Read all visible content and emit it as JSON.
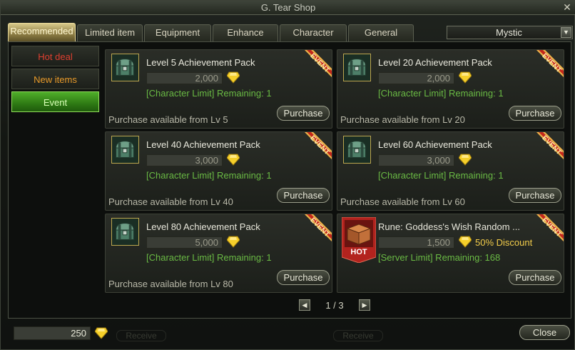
{
  "window": {
    "title": "G. Tear Shop",
    "close_symbol": "✕"
  },
  "tabs": [
    "Recommended",
    "Limited item",
    "Equipment",
    "Enhance",
    "Character",
    "General"
  ],
  "active_tab": "Recommended",
  "server_select": {
    "value": "Mystic",
    "arrow": "▼"
  },
  "sidebar": [
    "Hot deal",
    "New items",
    "Event"
  ],
  "active_sidebar": "Event",
  "colors": {
    "hot_deal": "#e04030",
    "new_items": "#e89a2a",
    "active": "#d9ffb8",
    "limit_text": "#6aba44",
    "accent_gold": "#f2cc4a"
  },
  "products": [
    {
      "name": "Level 5 Achievement Pack",
      "price": "2,000",
      "limit": "[Character Limit] Remaining: 1",
      "availability": "Purchase available from Lv 5",
      "button": "Purchase",
      "badge": "EVENT",
      "icon": "green-chest-icon"
    },
    {
      "name": "Level 20 Achievement Pack",
      "price": "2,000",
      "limit": "[Character Limit] Remaining: 1",
      "availability": "Purchase available from Lv 20",
      "button": "Purchase",
      "badge": "EVENT",
      "icon": "green-chest-icon"
    },
    {
      "name": "Level 40 Achievement Pack",
      "price": "3,000",
      "limit": "[Character Limit] Remaining: 1",
      "availability": "Purchase available from Lv 40",
      "button": "Purchase",
      "badge": "EVENT",
      "icon": "green-chest-icon"
    },
    {
      "name": "Level 60 Achievement Pack",
      "price": "3,000",
      "limit": "[Character Limit] Remaining: 1",
      "availability": "Purchase available from Lv 60",
      "button": "Purchase",
      "badge": "EVENT",
      "icon": "green-chest-icon"
    },
    {
      "name": "Level 80 Achievement Pack",
      "price": "5,000",
      "limit": "[Character Limit] Remaining: 1",
      "availability": "Purchase available from Lv 80",
      "button": "Purchase",
      "badge": "EVENT",
      "icon": "green-chest-icon"
    },
    {
      "name": "Rune: Goddess's Wish Random ...",
      "price": "1,500",
      "discount": "50% Discount",
      "limit": "[Server Limit] Remaining: 168",
      "availability": "",
      "button": "Purchase",
      "badge": "EVENT",
      "icon_badge": "HOT",
      "icon": "wooden-box-icon"
    }
  ],
  "pagination": {
    "label": "1 / 3",
    "prev": "◀",
    "next": "▶"
  },
  "footer": {
    "balance": "250",
    "receive_1": "Receive",
    "receive_2": "Receive",
    "close": "Close"
  }
}
